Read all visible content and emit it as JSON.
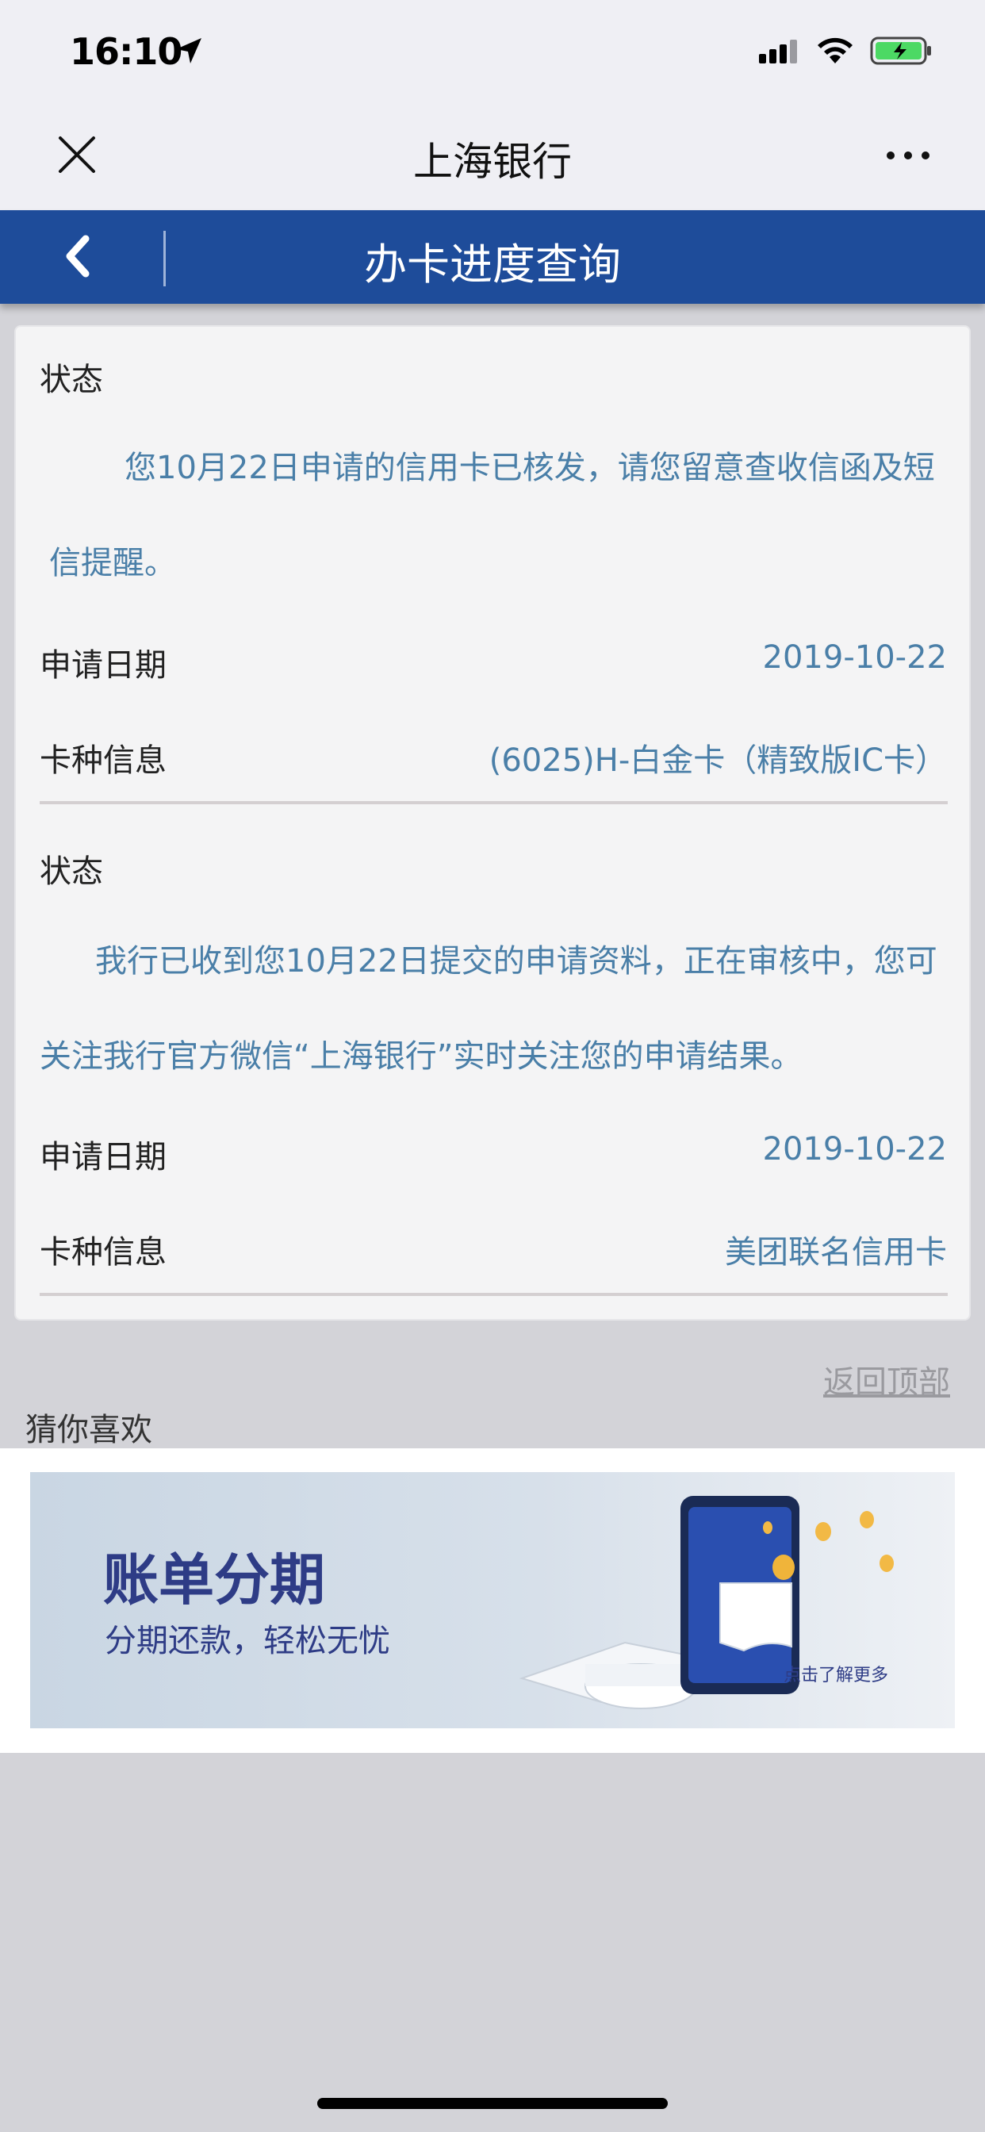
{
  "status_bar": {
    "time": "16:10",
    "icons": [
      "location-arrow-icon",
      "cellular-signal-icon",
      "wifi-icon",
      "battery-charging-icon"
    ]
  },
  "nav": {
    "title": "上海银行",
    "close_icon": "close-icon",
    "more_icon": "more-icon"
  },
  "header": {
    "title": "办卡进度查询",
    "back_icon": "back-chevron-icon"
  },
  "records": [
    {
      "status_label": "状态",
      "status_text": "您10月22日申请的信用卡已核发，请您留意查收信函及短信提醒。",
      "date_label": "申请日期",
      "date_value": "2019-10-22",
      "card_label": "卡种信息",
      "card_value": "(6025)H-白金卡（精致版IC卡）"
    },
    {
      "status_label": "状态",
      "status_text": "我行已收到您10月22日提交的申请资料，正在审核中，您可关注我行官方微信“上海银行”实时关注您的申请结果。",
      "date_label": "申请日期",
      "date_value": "2019-10-22",
      "card_label": "卡种信息",
      "card_value": "美团联名信用卡"
    }
  ],
  "back_to_top": "返回顶部",
  "recommend": {
    "label": "猜你喜欢",
    "banner_title": "账单分期",
    "banner_subtitle": "分期还款，轻松无忧",
    "banner_more": "点击了解更多"
  },
  "colors": {
    "header_bg": "#1e4c9a",
    "value_text": "#4a7fa8",
    "banner_text": "#2e3c86"
  }
}
